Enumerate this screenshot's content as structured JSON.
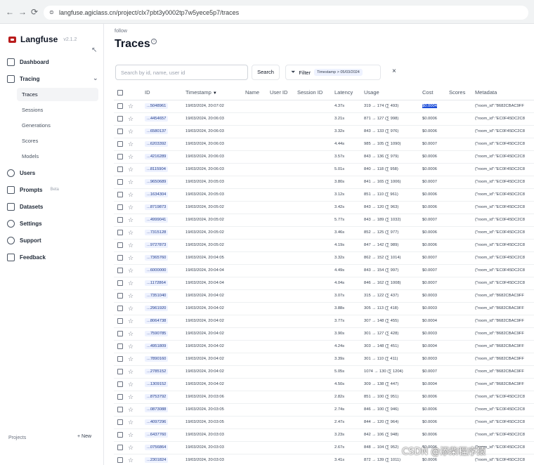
{
  "browser": {
    "url": "langfuse.agiclass.cn/project/clx7pbt3y0002tp7w5yece5p7/traces"
  },
  "app": {
    "name": "Langfuse",
    "version": "v2.1.2"
  },
  "sidebar": {
    "items": [
      {
        "label": "Dashboard",
        "icon": "dashboard-icon"
      },
      {
        "label": "Tracing",
        "icon": "tracing-icon"
      },
      {
        "label": "Users",
        "icon": "users-icon"
      },
      {
        "label": "Prompts",
        "icon": "prompts-icon",
        "badge": "Beta"
      },
      {
        "label": "Datasets",
        "icon": "database-icon"
      },
      {
        "label": "Settings",
        "icon": "gear-icon"
      },
      {
        "label": "Support",
        "icon": "support-icon"
      },
      {
        "label": "Feedback",
        "icon": "feedback-icon"
      }
    ],
    "tracing_sub": [
      "Traces",
      "Sessions",
      "Generations",
      "Scores",
      "Models"
    ],
    "active_sub": "Traces",
    "projects_label": "Projects",
    "new_label": "+ New"
  },
  "header": {
    "breadcrumb": "follow",
    "title": "Traces"
  },
  "toolbar": {
    "search_placeholder": "Search by id, name, user id",
    "search_label": "Search",
    "filter_label": "Filter",
    "filter_chip": "Timestamp > 05/03/2024",
    "clear_symbol": "×"
  },
  "table": {
    "columns": [
      "ID",
      "Timestamp",
      "Name",
      "User ID",
      "Session ID",
      "Latency",
      "Usage",
      "Cost",
      "Scores",
      "Metadata"
    ],
    "rows": [
      {
        "id": "...5048961",
        "timestamp": "19/03/2024, 20:07:02",
        "latency": "4.37s",
        "usage": "319 → 174 (∑ 493)",
        "cost": "$0.0004",
        "metadata": "{\"room_id\":\"8682CBAC9FF"
      },
      {
        "id": "...4454657",
        "timestamp": "19/03/2024, 20:06:03",
        "latency": "3.21s",
        "usage": "871 → 127 (∑ 998)",
        "cost": "$0.0006",
        "metadata": "{\"room_id\":\"EC0F45DC2C8"
      },
      {
        "id": "...6580137",
        "timestamp": "19/03/2024, 20:06:03",
        "latency": "3.32s",
        "usage": "843 → 133 (∑ 976)",
        "cost": "$0.0006",
        "metadata": "{\"room_id\":\"EC0F45DC2C8"
      },
      {
        "id": "...6203392",
        "timestamp": "19/03/2024, 20:06:03",
        "latency": "4.44s",
        "usage": "985 → 105 (∑ 1090)",
        "cost": "$0.0007",
        "metadata": "{\"room_id\":\"EC0F45DC2C8"
      },
      {
        "id": "...4216289",
        "timestamp": "19/03/2024, 20:06:03",
        "latency": "3.57s",
        "usage": "843 → 136 (∑ 979)",
        "cost": "$0.0006",
        "metadata": "{\"room_id\":\"EC0F45DC2C8"
      },
      {
        "id": "...8115904",
        "timestamp": "19/03/2024, 20:06:03",
        "latency": "5.01s",
        "usage": "840 → 118 (∑ 958)",
        "cost": "$0.0006",
        "metadata": "{\"room_id\":\"EC0F45DC2C8"
      },
      {
        "id": "...9650689",
        "timestamp": "19/03/2024, 20:05:03",
        "latency": "3.80s",
        "usage": "841 → 165 (∑ 1006)",
        "cost": "$0.0007",
        "metadata": "{\"room_id\":\"EC0F45DC2C8"
      },
      {
        "id": "...1634304",
        "timestamp": "19/03/2024, 20:05:03",
        "latency": "3.12s",
        "usage": "851 → 110 (∑ 961)",
        "cost": "$0.0006",
        "metadata": "{\"room_id\":\"EC0F45DC2C8"
      },
      {
        "id": "...8719873",
        "timestamp": "19/03/2024, 20:05:02",
        "latency": "3.42s",
        "usage": "843 → 120 (∑ 963)",
        "cost": "$0.0006",
        "metadata": "{\"room_id\":\"EC0F45DC2C8"
      },
      {
        "id": "...4999041",
        "timestamp": "19/03/2024, 20:05:02",
        "latency": "5.77s",
        "usage": "843 → 189 (∑ 1032)",
        "cost": "$0.0007",
        "metadata": "{\"room_id\":\"EC0F45DC2C8"
      },
      {
        "id": "...7315128",
        "timestamp": "19/03/2024, 20:05:02",
        "latency": "3.46s",
        "usage": "852 → 125 (∑ 977)",
        "cost": "$0.0006",
        "metadata": "{\"room_id\":\"EC0F45DC2C8"
      },
      {
        "id": "...9727873",
        "timestamp": "19/03/2024, 20:05:02",
        "latency": "4.19s",
        "usage": "847 → 142 (∑ 989)",
        "cost": "$0.0006",
        "metadata": "{\"room_id\":\"EC0F45DC2C8"
      },
      {
        "id": "...7365760",
        "timestamp": "19/03/2024, 20:04:05",
        "latency": "3.32s",
        "usage": "862 → 152 (∑ 1014)",
        "cost": "$0.0007",
        "metadata": "{\"room_id\":\"EC0F45DC2C8"
      },
      {
        "id": "...6000000",
        "timestamp": "19/03/2024, 20:04:04",
        "latency": "4.49s",
        "usage": "843 → 154 (∑ 997)",
        "cost": "$0.0007",
        "metadata": "{\"room_id\":\"EC0F45DC2C8"
      },
      {
        "id": "...1172864",
        "timestamp": "19/03/2024, 20:04:04",
        "latency": "4.04s",
        "usage": "846 → 162 (∑ 1008)",
        "cost": "$0.0007",
        "metadata": "{\"room_id\":\"EC0F45DC2C8"
      },
      {
        "id": "...7351040",
        "timestamp": "19/03/2024, 20:04:02",
        "latency": "3.07s",
        "usage": "315 → 122 (∑ 437)",
        "cost": "$0.0003",
        "metadata": "{\"room_id\":\"8682CBAC9FF"
      },
      {
        "id": "...2961920",
        "timestamp": "19/03/2024, 20:04:02",
        "latency": "3.88s",
        "usage": "305 → 113 (∑ 418)",
        "cost": "$0.0003",
        "metadata": "{\"room_id\":\"8682CBAC9FF"
      },
      {
        "id": "...8064738",
        "timestamp": "19/03/2024, 20:04:02",
        "latency": "3.77s",
        "usage": "307 → 148 (∑ 455)",
        "cost": "$0.0004",
        "metadata": "{\"room_id\":\"8682CBAC9FF"
      },
      {
        "id": "...7590785",
        "timestamp": "19/03/2024, 20:04:02",
        "latency": "3.90s",
        "usage": "301 → 127 (∑ 428)",
        "cost": "$0.0003",
        "metadata": "{\"room_id\":\"8682CBAC9FF"
      },
      {
        "id": "...4951809",
        "timestamp": "19/03/2024, 20:04:02",
        "latency": "4.24s",
        "usage": "303 → 148 (∑ 451)",
        "cost": "$0.0004",
        "metadata": "{\"room_id\":\"8682CBAC9FF"
      },
      {
        "id": "...7890160",
        "timestamp": "19/03/2024, 20:04:02",
        "latency": "3.39s",
        "usage": "301 → 110 (∑ 411)",
        "cost": "$0.0003",
        "metadata": "{\"room_id\":\"8682CBAC9FF"
      },
      {
        "id": "...2785152",
        "timestamp": "19/03/2024, 20:04:02",
        "latency": "5.05s",
        "usage": "1074 → 130 (∑ 1204)",
        "cost": "$0.0007",
        "metadata": "{\"room_id\":\"8682CBAC9FF"
      },
      {
        "id": "...1309152",
        "timestamp": "19/03/2024, 20:04:02",
        "latency": "4.50s",
        "usage": "309 → 138 (∑ 447)",
        "cost": "$0.0004",
        "metadata": "{\"room_id\":\"8682CBAC9FF"
      },
      {
        "id": "...8753792",
        "timestamp": "19/03/2024, 20:03:06",
        "latency": "2.82s",
        "usage": "851 → 100 (∑ 951)",
        "cost": "$0.0006",
        "metadata": "{\"room_id\":\"EC0F45DC2C8"
      },
      {
        "id": "...0873088",
        "timestamp": "19/03/2024, 20:03:05",
        "latency": "2.74s",
        "usage": "846 → 100 (∑ 946)",
        "cost": "$0.0006",
        "metadata": "{\"room_id\":\"EC0F45DC2C8"
      },
      {
        "id": "...4097296",
        "timestamp": "19/03/2024, 20:03:05",
        "latency": "2.47s",
        "usage": "844 → 120 (∑ 964)",
        "cost": "$0.0006",
        "metadata": "{\"room_id\":\"EC0F45DC2C8"
      },
      {
        "id": "...6437760",
        "timestamp": "19/03/2024, 20:03:03",
        "latency": "3.23s",
        "usage": "842 → 106 (∑ 948)",
        "cost": "$0.0006",
        "metadata": "{\"room_id\":\"EC0F45DC2C8"
      },
      {
        "id": "...0756864",
        "timestamp": "19/03/2024, 20:03:03",
        "latency": "2.67s",
        "usage": "848 → 104 (∑ 952)",
        "cost": "$0.0006",
        "metadata": "{\"room_id\":\"EC0F45DC2C8"
      },
      {
        "id": "...2301824",
        "timestamp": "19/03/2024, 20:03:03",
        "latency": "3.41s",
        "usage": "872 → 139 (∑ 1011)",
        "cost": "$0.0006",
        "metadata": "{\"room_id\":\"EC0F45DC2C8"
      }
    ],
    "highlighted_cost_row": 0,
    "sort_indicator": "▼"
  },
  "watermark": "CSDN @添柴程序猿",
  "colors": {
    "accent": "#1d4ed8",
    "logo": "#b91c1c",
    "id_chip_bg": "#eef2ff"
  }
}
